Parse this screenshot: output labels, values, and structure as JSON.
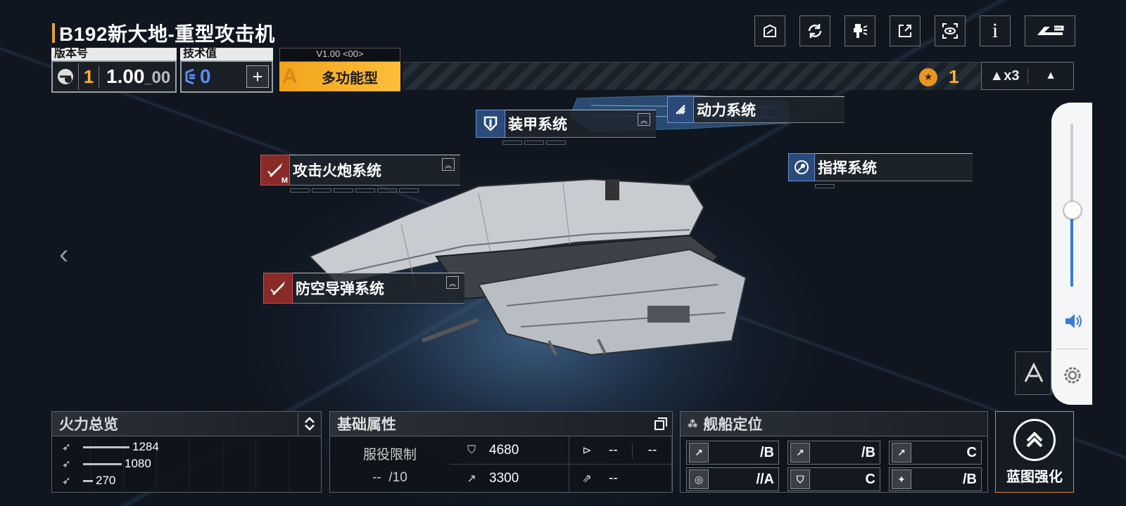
{
  "ship": {
    "title": "B192新大地-重型攻击机"
  },
  "top_icons": [
    "blueprint-icon",
    "refresh-icon",
    "paint-icon",
    "share-icon",
    "view-icon",
    "info-icon",
    "back-icon"
  ],
  "info_icon_text": "i",
  "version": {
    "label": "版本号",
    "level": "1",
    "value": "1.00",
    "sub": "00"
  },
  "tech": {
    "label": "技术值",
    "value": "0",
    "add_symbol": "+"
  },
  "type_tag": {
    "version_text": "V1.00 <00>",
    "grade": "A",
    "type": "多功能型"
  },
  "resource": {
    "count": "1",
    "mult": "▲x3"
  },
  "systems": {
    "armor": {
      "label": "装甲系统"
    },
    "power": {
      "label": "动力系统"
    },
    "cannon": {
      "label": "攻击火炮系统",
      "badge": "M"
    },
    "command": {
      "label": "指挥系统"
    },
    "aa_missile": {
      "label": "防空导弹系统"
    }
  },
  "firepower": {
    "title": "火力总览",
    "rows": [
      {
        "icon": "anti-ship-icon",
        "value": "1284",
        "ratio": 1.0
      },
      {
        "icon": "anti-air-icon",
        "value": "1080",
        "ratio": 0.84
      },
      {
        "icon": "siege-icon",
        "value": "270",
        "ratio": 0.21
      }
    ]
  },
  "attributes": {
    "title": "基础属性",
    "hp": "4680",
    "armor_a": "--",
    "armor_b": "--",
    "speed": "3300",
    "warp": "--",
    "limit_label": "服役限制",
    "limit_value": "--",
    "limit_max": "/10"
  },
  "positioning": {
    "title": "舰船定位",
    "grades": [
      {
        "icon": "a1",
        "value": "/B"
      },
      {
        "icon": "a2",
        "value": "/B"
      },
      {
        "icon": "a3",
        "value": "C"
      },
      {
        "icon": "b1",
        "value": "//A"
      },
      {
        "icon": "b2",
        "value": "C"
      },
      {
        "icon": "b3",
        "value": "/B"
      }
    ]
  },
  "upgrade": {
    "label": "蓝图强化"
  },
  "colors": {
    "accent": "#f0a41c",
    "tech_blue": "#5a8cff",
    "volume_blue": "#3a7bd5"
  }
}
